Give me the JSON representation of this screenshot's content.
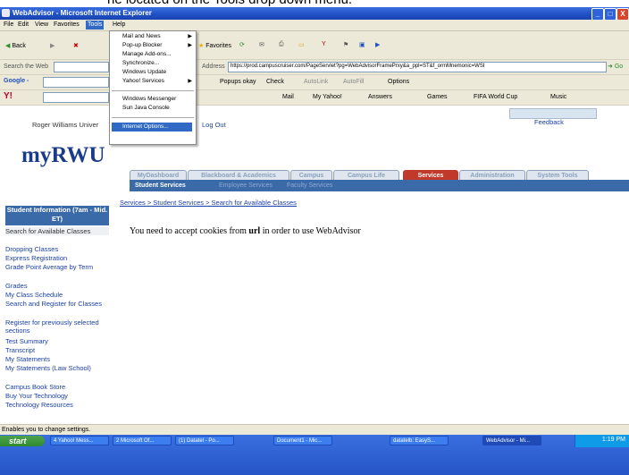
{
  "caption": "he located on the Tools drop down menu.",
  "window": {
    "title": "WebAdvisor - Microsoft Internet Explorer",
    "controls": [
      "_",
      "□",
      "X"
    ]
  },
  "menubar": [
    "File",
    "Edit",
    "View",
    "Favorites",
    "Tools",
    "Help"
  ],
  "toolbar": {
    "back": "Back",
    "favorites": "Favorites",
    "address_label": "Address",
    "address": "https://prod.campuscruiser.com/PageServlet?pg=WebAdvisorFramePrxy&a_ppl=ST&f_ormMnemonic=WSI",
    "go": "Go",
    "search_web": "Search the Web",
    "google": "Google -",
    "popups": "Popups okay",
    "check": "Check",
    "autolink": "AutoLink",
    "autofill": "AutoFill",
    "options": "Options",
    "yahoo": "Y!",
    "mail": "Mail",
    "my_yahoo": "My Yahoo!",
    "answers": "Answers",
    "games": "Games",
    "fifa": "FIFA World Cup",
    "music": "Music"
  },
  "tools_menu": {
    "items": [
      {
        "label": "Mail and News",
        "arrow": true
      },
      {
        "label": "Pop-up Blocker",
        "arrow": true
      },
      {
        "label": "Manage Add-ons...",
        "arrow": false
      },
      {
        "label": "Synchronize...",
        "arrow": false
      },
      {
        "label": "Windows Update",
        "arrow": false
      },
      {
        "label": "Yahoo! Services",
        "arrow": true
      },
      {
        "label": "Windows Messenger",
        "arrow": false
      },
      {
        "label": "Sun Java Console",
        "arrow": false
      },
      {
        "label": "Internet Options...",
        "arrow": false
      }
    ]
  },
  "page": {
    "user": "Roger Williams Univer",
    "logout": "Log Out",
    "feedback": "Feedback",
    "logo": "myRWU",
    "tabs": [
      "MyDashboard",
      "Blackboard & Academics",
      "Campus",
      "Campus Life",
      "Services",
      "Administration",
      "System Tools"
    ],
    "subtabs": [
      "Student Services",
      "Employee Services",
      "Faculty Services"
    ],
    "breadcrumb": "Services > Student Services > Search for Available Classes",
    "message_pre": "You need to accept cookies from ",
    "message_bold": "url",
    "message_post": " in order to use WebAdvisor",
    "sidebar_header": "Student Information (7am - Mid. ET)",
    "sidebar": [
      "Search for Available Classes",
      "Dropping Classes",
      "Express Registration",
      "Grade Point Average by Term",
      "Grades",
      "My Class Schedule",
      "Search and Register for Classes",
      "Register for previously selected sections",
      "Test Summary",
      "Transcript",
      "My Statements",
      "My Statements (Law School)",
      "Campus Book Store",
      "Buy Your Technology",
      "Technology Resources"
    ]
  },
  "status": "Enables you to change settings.",
  "taskbar": {
    "start": "start",
    "tasks": [
      "4 Yahoo! Mess...",
      "2 Microsoft Of...",
      "(1) Datatel - Po...",
      "Document1 - Mic...",
      "datatelb: EasyS...",
      "WebAdvisor - Mi..."
    ],
    "clock": "1:19 PM"
  }
}
